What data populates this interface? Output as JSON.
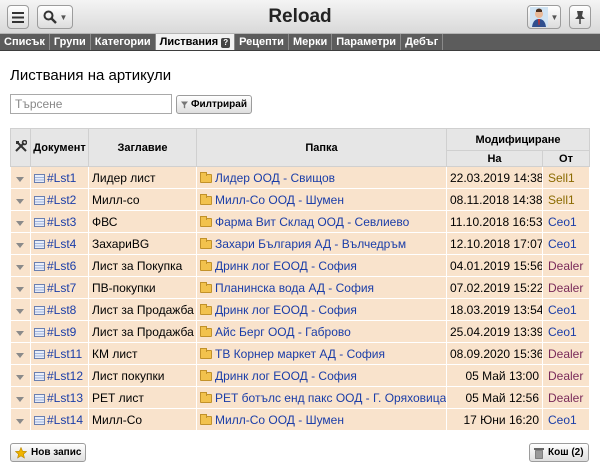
{
  "app": {
    "title": "Reload"
  },
  "toolbar": {
    "menu_icon": "hamburger-menu-icon",
    "search_icon": "magnifier-icon",
    "avatar_icon": "user-avatar-icon",
    "pin_icon": "pin-icon"
  },
  "tabs": [
    {
      "label": "Списък",
      "active": false
    },
    {
      "label": "Групи",
      "active": false
    },
    {
      "label": "Категории",
      "active": false
    },
    {
      "label": "Листвания",
      "active": true,
      "badge": "?"
    },
    {
      "label": "Рецепти",
      "active": false
    },
    {
      "label": "Мерки",
      "active": false
    },
    {
      "label": "Параметри",
      "active": false
    },
    {
      "label": "Дебъг",
      "active": false
    }
  ],
  "page": {
    "title": "Листвания на артикули"
  },
  "search": {
    "placeholder": "Търсене",
    "filter_label": "Филтрирай"
  },
  "table": {
    "headers": {
      "document": "Документ",
      "title": "Заглавие",
      "folder": "Папка",
      "modified": "Модифициране",
      "on": "На",
      "by": "От"
    },
    "rows": [
      {
        "doc": "#Lst1",
        "title": "Лидер лист",
        "folder": "Лидер ООД - Свищов",
        "date": "22.03.2019 14:38",
        "user": "Sell1",
        "role": "sell"
      },
      {
        "doc": "#Lst2",
        "title": "Милл-со",
        "folder": "Милл-Со ООД - Шумен",
        "date": "08.11.2018 14:38",
        "user": "Sell1",
        "role": "sell"
      },
      {
        "doc": "#Lst3",
        "title": "ФВС",
        "folder": "Фарма Вит Склад ООД - Севлиево",
        "date": "11.10.2018 16:53",
        "user": "Ceo1",
        "role": "ceo"
      },
      {
        "doc": "#Lst4",
        "title": "ЗахариBG",
        "folder": "Захари България АД - Вълчедръм",
        "date": "12.10.2018 17:07",
        "user": "Ceo1",
        "role": "ceo"
      },
      {
        "doc": "#Lst6",
        "title": "Лист за Покупка",
        "folder": "Дринк лог ЕООД - София",
        "date": "04.01.2019 15:56",
        "user": "Dealer",
        "role": "dealer"
      },
      {
        "doc": "#Lst7",
        "title": "ПВ-покупки",
        "folder": "Планинска вода АД - София",
        "date": "07.02.2019 15:22",
        "user": "Dealer",
        "role": "dealer"
      },
      {
        "doc": "#Lst8",
        "title": "Лист за Продажба",
        "folder": "Дринк лог ЕООД - София",
        "date": "18.03.2019 13:54",
        "user": "Ceo1",
        "role": "ceo"
      },
      {
        "doc": "#Lst9",
        "title": "Лист за Продажба",
        "folder": "Айс Берг ООД - Габрово",
        "date": "25.04.2019 13:39",
        "user": "Ceo1",
        "role": "ceo"
      },
      {
        "doc": "#Lst11",
        "title": "КМ лист",
        "folder": "ТВ Корнер маркет АД - София",
        "date": "08.09.2020 15:36",
        "user": "Dealer",
        "role": "dealer"
      },
      {
        "doc": "#Lst12",
        "title": "Лист покупки",
        "folder": "Дринк лог ЕООД - София",
        "date": "05 Май 13:00",
        "user": "Dealer",
        "role": "dealer"
      },
      {
        "doc": "#Lst13",
        "title": "РЕТ лист",
        "folder": "РЕТ ботълс енд пакс ООД - Г. Оряховица",
        "date": "05 Май 12:56",
        "user": "Dealer",
        "role": "dealer"
      },
      {
        "doc": "#Lst14",
        "title": "Милл-Со",
        "folder": "Милл-Со ООД - Шумен",
        "date": "17 Юни 16:20",
        "user": "Ceo1",
        "role": "ceo"
      }
    ]
  },
  "footer": {
    "new_record": "Нов запис",
    "trash": "Кош (2)"
  }
}
